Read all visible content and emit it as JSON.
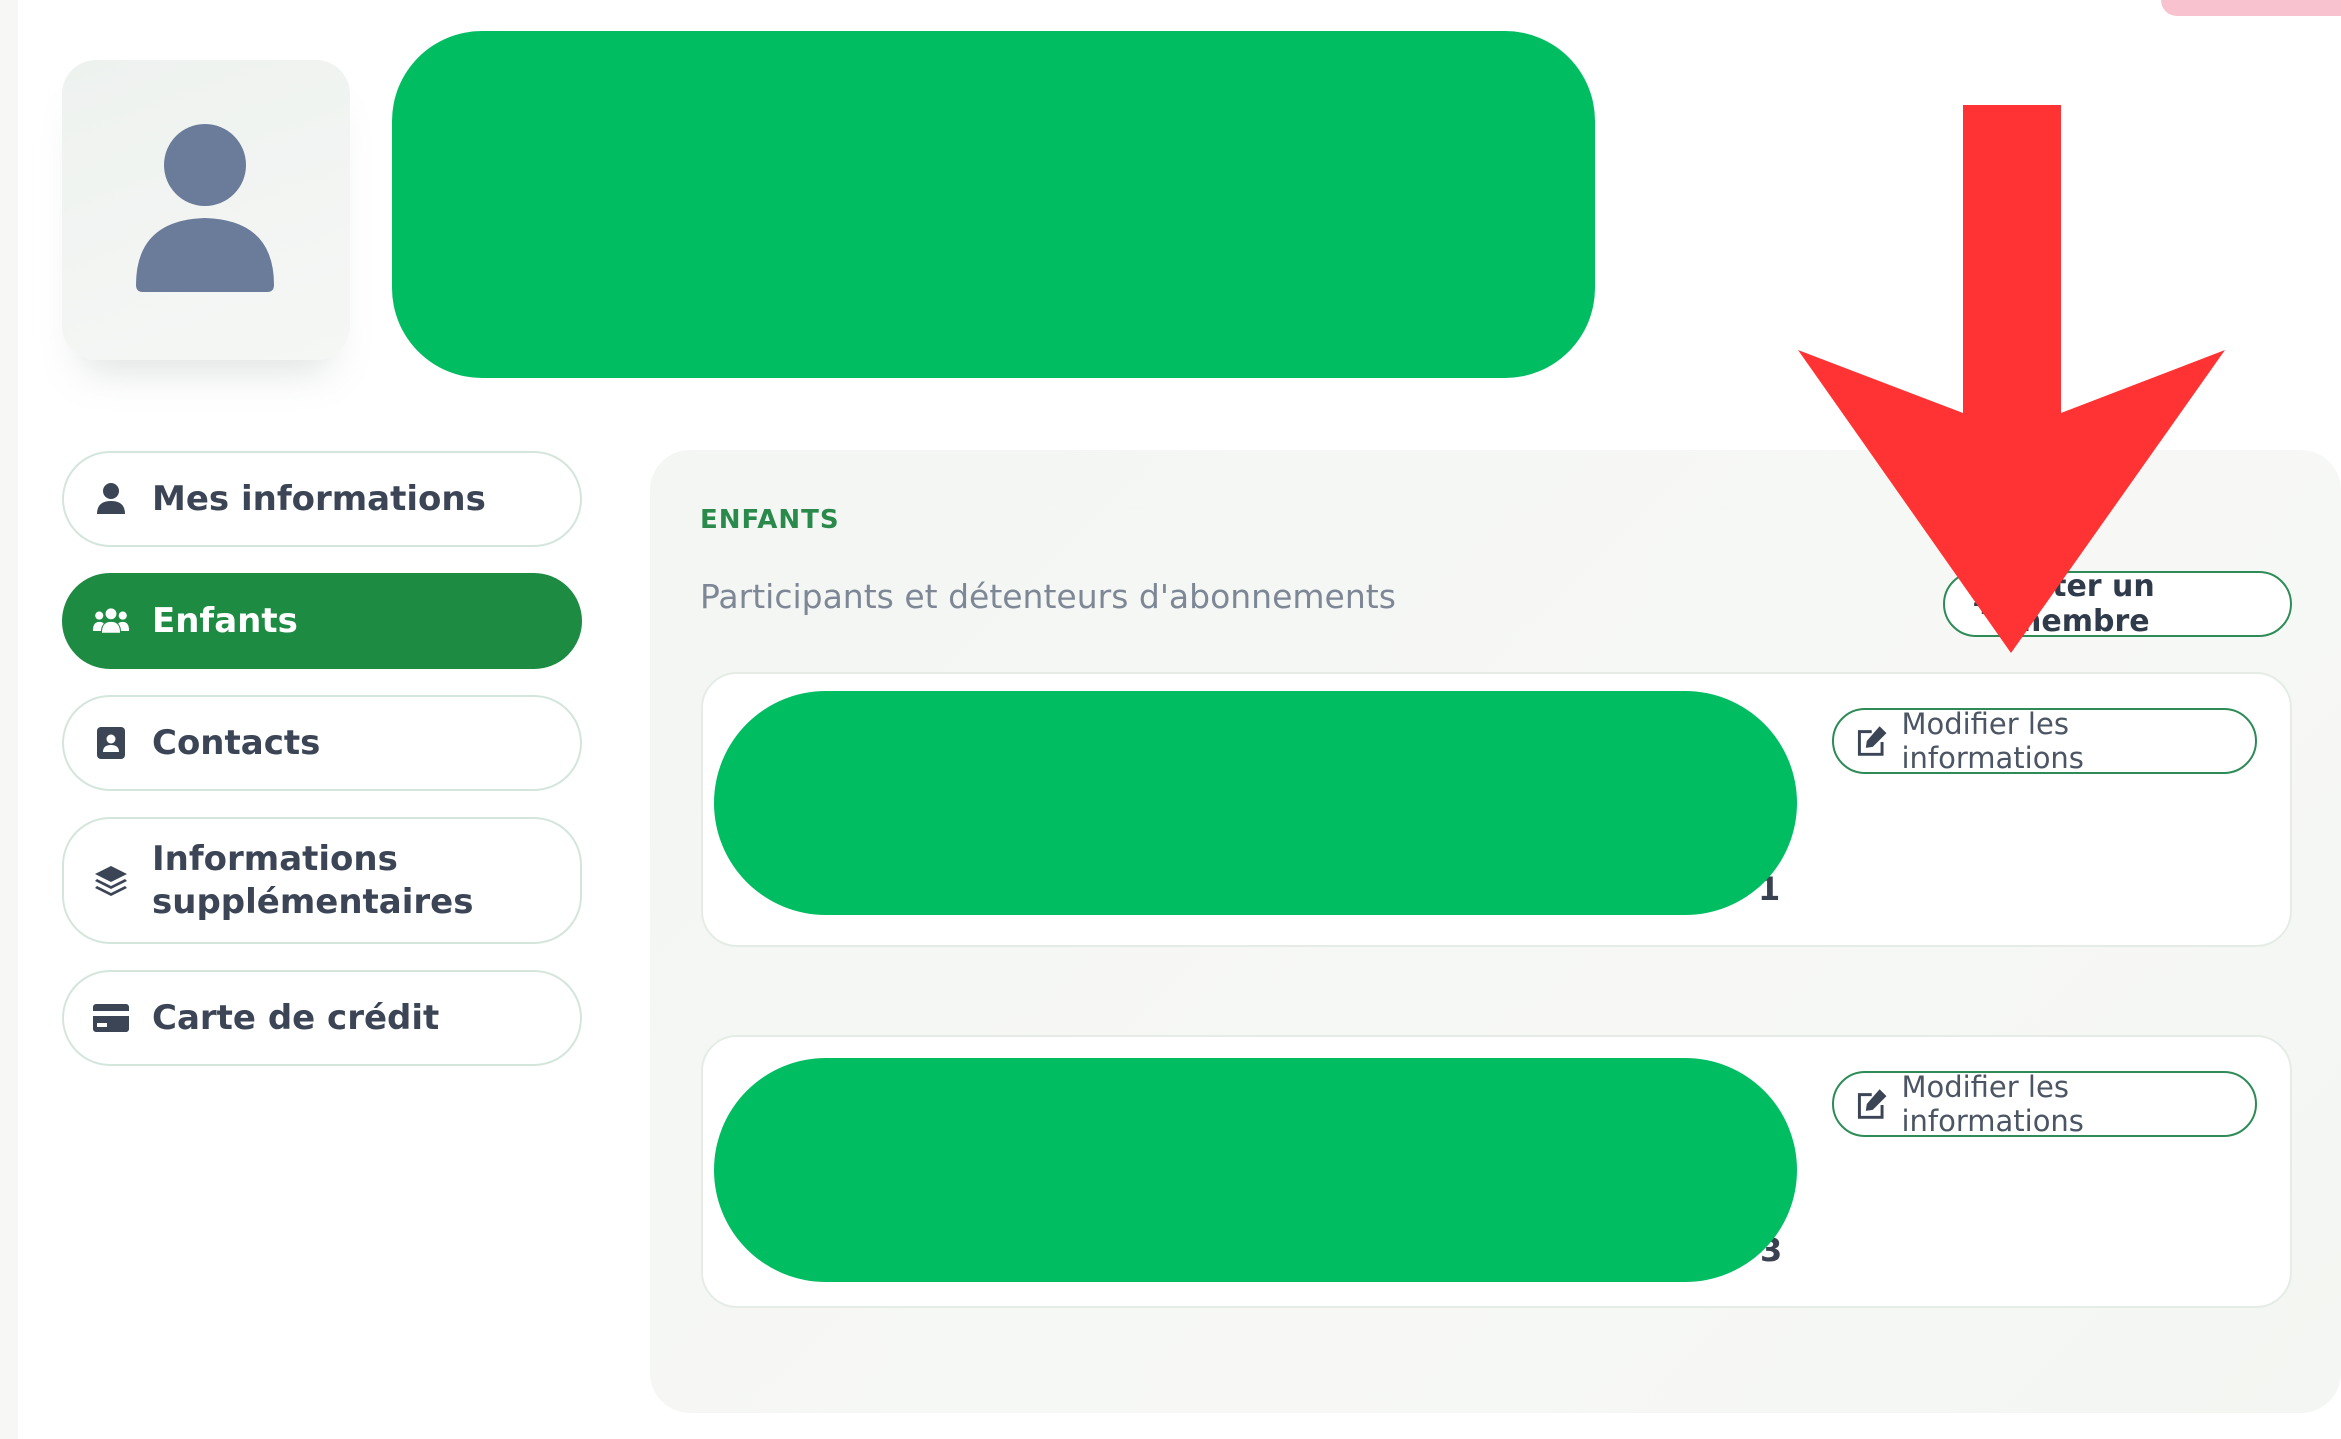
{
  "colors": {
    "accent": "#1e8b43",
    "redaction": "#00bd62",
    "annotation_arrow": "#ff3333",
    "section_label": "#2a8a4c"
  },
  "sidebar": {
    "items": [
      {
        "label": "Mes informations",
        "icon": "user-icon"
      },
      {
        "label": "Enfants",
        "icon": "users-icon",
        "active": true
      },
      {
        "label": "Contacts",
        "icon": "address-book-icon"
      },
      {
        "label_line1": "Informations",
        "label_line2": "supplémentaires",
        "icon": "layers-icon"
      },
      {
        "label": "Carte de crédit",
        "icon": "credit-card-icon"
      }
    ]
  },
  "main": {
    "section_title": "ENFANTS",
    "section_subtitle": "Participants et détenteurs d'abonnements",
    "add_member_label": "outer un membre",
    "children": [
      {
        "edit_label": "Modifier les informations",
        "trailing_digit": "1"
      },
      {
        "edit_label": "Modifier les informations",
        "trailing_digit": "3"
      }
    ]
  }
}
